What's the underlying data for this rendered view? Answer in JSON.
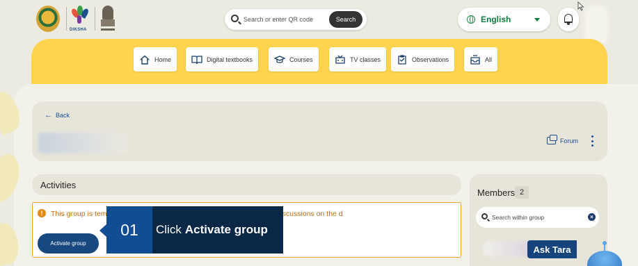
{
  "header": {
    "diksha_label": "DIKSHA",
    "search": {
      "placeholder": "Search or enter QR code",
      "button_label": "Search"
    },
    "language": {
      "selected": "English"
    }
  },
  "nav": {
    "items": [
      {
        "label": "Home",
        "icon": "home-icon"
      },
      {
        "label": "Digital textbooks",
        "icon": "book-icon"
      },
      {
        "label": "Courses",
        "icon": "graduation-cap-icon"
      },
      {
        "label": "TV classes",
        "icon": "tv-icon"
      },
      {
        "label": "Observations",
        "icon": "clipboard-icon"
      },
      {
        "label": "All",
        "icon": "inbox-icon"
      }
    ]
  },
  "group": {
    "back_label": "Back",
    "forum_label": "Forum"
  },
  "activities": {
    "title": "Activities",
    "alert_text": "This group is tem                                                                                   roup if required. Group members can continue their discussions on the d",
    "activate_label": "Activate group"
  },
  "members": {
    "title": "Members",
    "count": "2",
    "search_placeholder": "Search within group"
  },
  "assistant": {
    "label": "Ask Tara"
  },
  "tutorial": {
    "step": "01",
    "text_prefix": "Click",
    "text_bold": "Activate group"
  },
  "colors": {
    "nav_band": "#fed44e",
    "primary_blue": "#17487f",
    "alert_orange": "#e58a13",
    "language_green": "#0f7a3e"
  }
}
